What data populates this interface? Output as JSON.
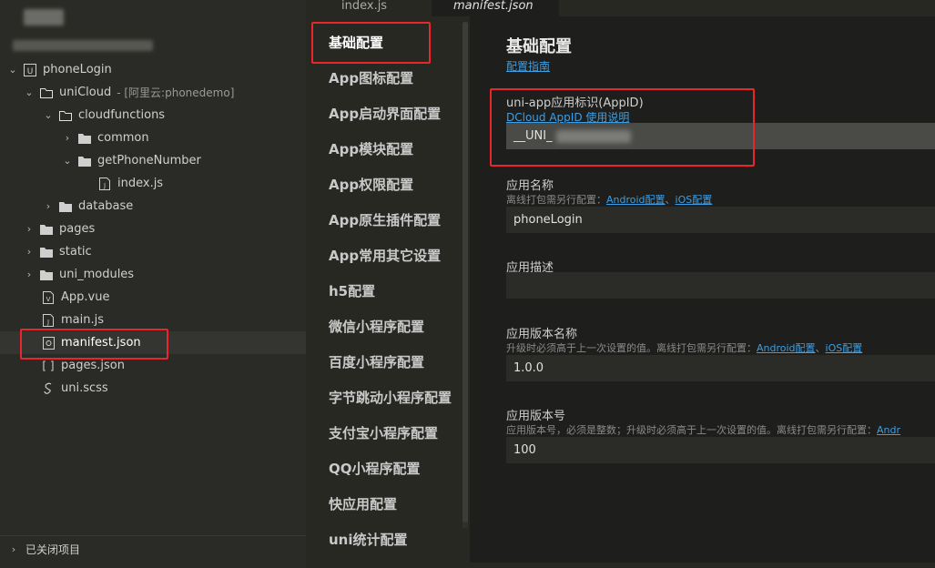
{
  "explorer": {
    "project": "phoneLogin",
    "items": [
      {
        "label": "uniCloud",
        "meta": "- [阿里云:phonedemo]"
      },
      {
        "label": "cloudfunctions"
      },
      {
        "label": "common"
      },
      {
        "label": "getPhoneNumber"
      },
      {
        "label": "index.js"
      },
      {
        "label": "database"
      },
      {
        "label": "pages"
      },
      {
        "label": "static"
      },
      {
        "label": "uni_modules"
      },
      {
        "label": "App.vue"
      },
      {
        "label": "main.js"
      },
      {
        "label": "manifest.json"
      },
      {
        "label": "pages.json"
      },
      {
        "label": "uni.scss"
      }
    ],
    "closed_projects": "已关闭项目"
  },
  "tabs": [
    {
      "label": "index.js"
    },
    {
      "label": "manifest.json"
    }
  ],
  "nav": {
    "items": [
      "基础配置",
      "App图标配置",
      "App启动界面配置",
      "App模块配置",
      "App权限配置",
      "App原生插件配置",
      "App常用其它设置",
      "h5配置",
      "微信小程序配置",
      "百度小程序配置",
      "字节跳动小程序配置",
      "支付宝小程序配置",
      "QQ小程序配置",
      "快应用配置",
      "uni统计配置"
    ]
  },
  "form": {
    "title": "基础配置",
    "guide_link": "配置指南",
    "appid": {
      "label": "uni-app应用标识(AppID)",
      "help_link": "DCloud AppID 使用说明",
      "value": "__UNI_"
    },
    "app_name": {
      "label": "应用名称",
      "hint": "离线打包需另行配置：",
      "android_link": "Android配置",
      "sep": "、",
      "ios_link": "iOS配置",
      "value": "phoneLogin"
    },
    "app_desc": {
      "label": "应用描述",
      "value": ""
    },
    "version_name": {
      "label": "应用版本名称",
      "hint": "升级时必须高于上一次设置的值。离线打包需另行配置：",
      "android_link": "Android配置",
      "sep": "、",
      "ios_link": "iOS配置",
      "value": "1.0.0"
    },
    "version_code": {
      "label": "应用版本号",
      "hint": "应用版本号，必须是整数；升级时必须高于上一次设置的值。离线打包需另行配置：",
      "android_link": "Andr",
      "value": "100"
    }
  },
  "colors": {
    "accent_link": "#3c9ee5",
    "highlight_box": "#e8262b"
  }
}
